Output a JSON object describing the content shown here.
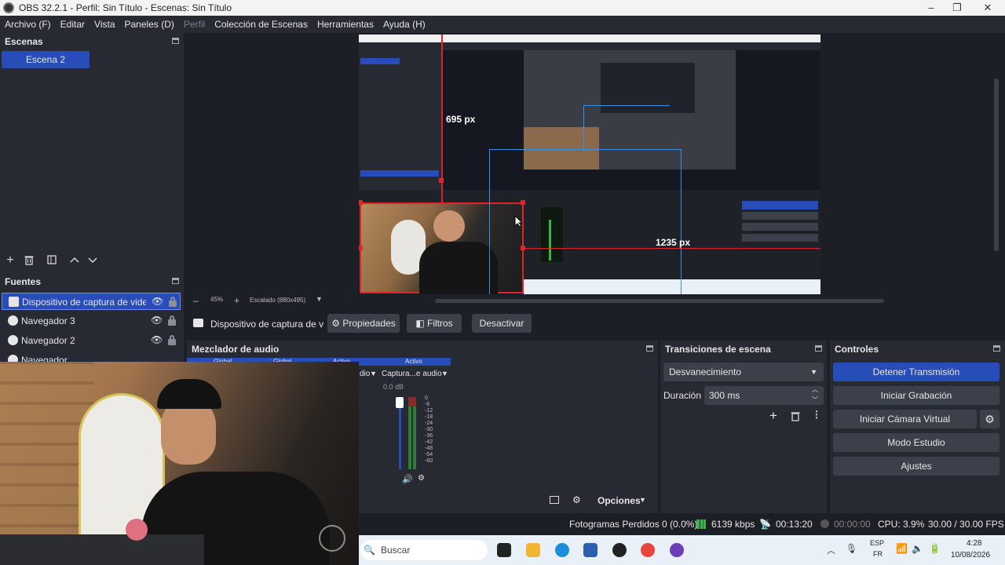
{
  "window": {
    "title": "OBS 32.2.1 - Perfil: Sin Título - Escenas: Sin Título",
    "minimize": "–",
    "maximize": "❐",
    "close": "✕"
  },
  "menu": {
    "items": [
      "Archivo (F)",
      "Editar",
      "Vista",
      "Paneles (D)",
      "Perfil",
      "Colección de Escenas",
      "Herramientas",
      "Ayuda (H)"
    ]
  },
  "scenes": {
    "title": "Escenas",
    "items": [
      "Escena 2"
    ]
  },
  "sources": {
    "title": "Fuentes",
    "items": [
      {
        "label": "Dispositivo de captura de video",
        "icon": "camera-icon"
      },
      {
        "label": "Navegador 3",
        "icon": "globe-icon"
      },
      {
        "label": "Navegador 2",
        "icon": "globe-icon"
      },
      {
        "label": "Navegador",
        "icon": "globe-icon"
      }
    ]
  },
  "preview": {
    "zoom": "45%",
    "scaling": "Escalado (880x495)",
    "dim_vertical": "695 px",
    "dim_horizontal": "1235 px"
  },
  "source_toolbar": {
    "source_name": "Dispositivo de captura de v",
    "properties": "Propiedades",
    "filters": "Filtros",
    "deactivate": "Desactivar"
  },
  "mixer": {
    "title": "Mezclador de audio",
    "header_labels": [
      "Global",
      "Global",
      "Activo",
      "Activo"
    ],
    "channel_partial": "dio",
    "channel_name": "Captura...e audio",
    "db": "0.0 dB",
    "ticks": [
      "0",
      "-6",
      "-12",
      "-18",
      "-24",
      "-30",
      "-36",
      "-42",
      "-48",
      "-54",
      "-60"
    ],
    "options": "Opciones"
  },
  "transitions": {
    "title": "Transiciones de escena",
    "selected": "Desvanecimiento",
    "duration_label": "Duración",
    "duration_value": "300 ms"
  },
  "controls": {
    "title": "Controles",
    "stop_stream": "Detener Transmisión",
    "start_recording": "Iniciar Grabación",
    "start_virtual_cam": "Iniciar Cámara Virtual",
    "studio_mode": "Modo Estudio",
    "settings": "Ajustes"
  },
  "statusbar": {
    "dropped": "Fotogramas Perdidos 0 (0.0%)",
    "bitrate": "6139 kbps",
    "stream_time": "00:13:20",
    "rec_time": "00:00:00",
    "cpu": "CPU: 3.9%",
    "fps": "30.00 / 30.00 FPS"
  },
  "taskbar": {
    "search": "Buscar",
    "lang_top": "ESP",
    "lang_bottom": "FR",
    "time": "4:28",
    "date": "10/08/2026"
  },
  "colors": {
    "accent": "#284cb8",
    "panel": "#272a33",
    "background": "#1d1f26",
    "selection_red": "#e0242c",
    "guide_blue": "#3a8ee6"
  }
}
